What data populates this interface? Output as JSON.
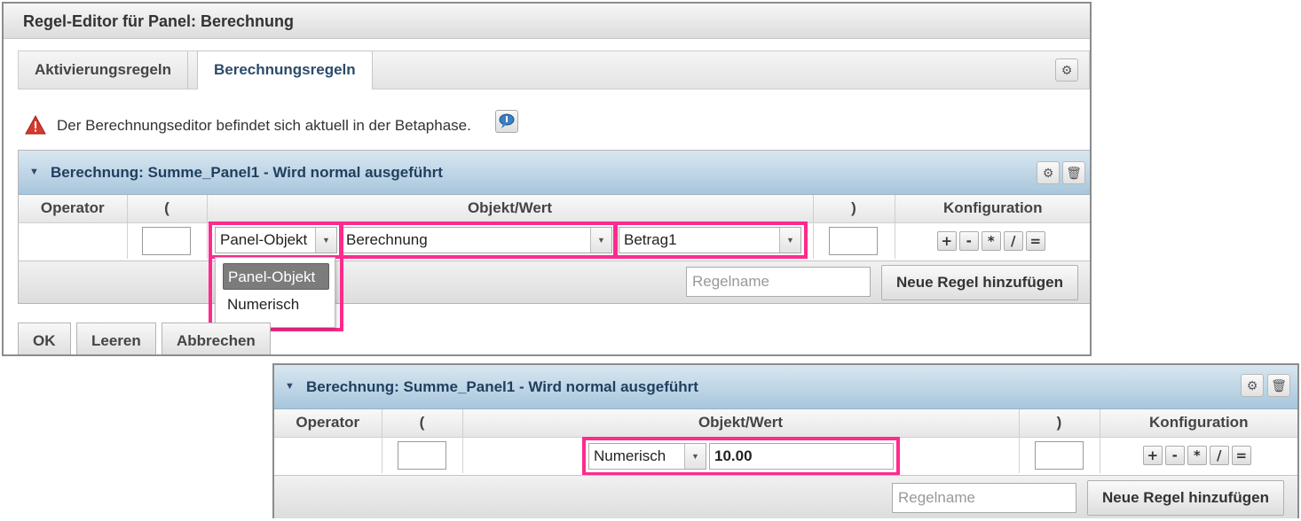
{
  "dialog": {
    "title": "Regel-Editor für Panel: Berechnung",
    "tabs": [
      {
        "label": "Aktivierungsregeln",
        "active": false
      },
      {
        "label": "Berechnungsregeln",
        "active": true
      }
    ],
    "settings_icon": "gear-icon",
    "warning": {
      "icon": "warning-triangle-icon",
      "text": "Der Berechnungseditor befindet sich aktuell in der Betaphase."
    },
    "help_icon": "speech-bubble-icon",
    "buttons": {
      "ok": "OK",
      "clear": "Leeren",
      "cancel": "Abbrechen"
    }
  },
  "rule_panel_1": {
    "header": "Berechnung:  Summe_Panel1 - Wird normal ausgeführt",
    "columns": [
      "Operator",
      "(",
      "Objekt/Wert",
      ")",
      "Konfiguration"
    ],
    "row": {
      "type_select": "Panel-Objekt",
      "panel_select": "Berechnung",
      "field_select": "Betrag1"
    },
    "dropdown_options": [
      {
        "label": "Panel-Objekt",
        "selected": true
      },
      {
        "label": "Numerisch",
        "selected": false
      }
    ],
    "operators": [
      "+",
      "-",
      "*",
      "/",
      "="
    ],
    "rule_name_placeholder": "Regelname",
    "add_rule_label": "Neue Regel hinzufügen"
  },
  "rule_panel_2": {
    "header": "Berechnung:  Summe_Panel1 - Wird normal ausgeführt",
    "columns": [
      "Operator",
      "(",
      "Objekt/Wert",
      ")",
      "Konfiguration"
    ],
    "row": {
      "type_select": "Numerisch",
      "value": "10.00"
    },
    "operators": [
      "+",
      "-",
      "*",
      "/",
      "="
    ],
    "rule_name_placeholder": "Regelname",
    "add_rule_label": "Neue Regel hinzufügen"
  },
  "colors": {
    "highlight": "#ff2a8d",
    "header_blue": "#a7c6dc",
    "header_text": "#1f3f5f"
  }
}
